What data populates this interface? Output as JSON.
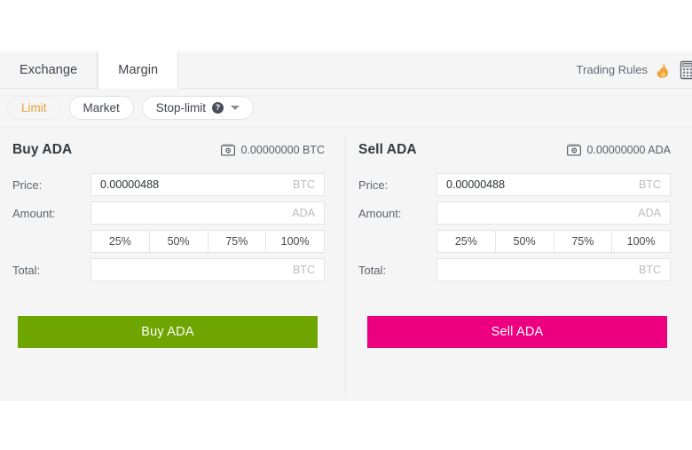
{
  "tabs": [
    {
      "label": "Exchange",
      "active": false,
      "name": "tab-exchange"
    },
    {
      "label": "Margin",
      "active": true,
      "name": "tab-margin"
    }
  ],
  "header": {
    "trading_rules_label": "Trading Rules",
    "flame_icon": "flame-icon",
    "calculator_icon": "calculator-icon"
  },
  "order_types": [
    {
      "label": "Limit",
      "selected": true
    },
    {
      "label": "Market",
      "selected": false
    },
    {
      "label": "Stop-limit",
      "selected": false,
      "help": "?",
      "has_caret": true
    }
  ],
  "labels": {
    "price": "Price:",
    "amount": "Amount:",
    "total": "Total:"
  },
  "percentages": [
    "25%",
    "50%",
    "75%",
    "100%"
  ],
  "buy": {
    "title": "Buy ADA",
    "balance": "0.00000000 BTC",
    "price_value": "0.00000488",
    "price_suffix": "BTC",
    "amount_value": "",
    "amount_suffix": "ADA",
    "total_value": "",
    "total_suffix": "BTC",
    "button_label": "Buy ADA",
    "button_color": "#6fa500"
  },
  "sell": {
    "title": "Sell ADA",
    "balance": "0.00000000 ADA",
    "price_value": "0.00000488",
    "price_suffix": "BTC",
    "amount_value": "",
    "amount_suffix": "ADA",
    "total_value": "",
    "total_suffix": "BTC",
    "button_label": "Sell ADA",
    "button_color": "#ed0080"
  },
  "theme": {
    "panel_bg": "#f5f5f5",
    "accent_selected": "#e8a33d",
    "buy_green": "#6fa500",
    "sell_pink": "#ed0080"
  }
}
